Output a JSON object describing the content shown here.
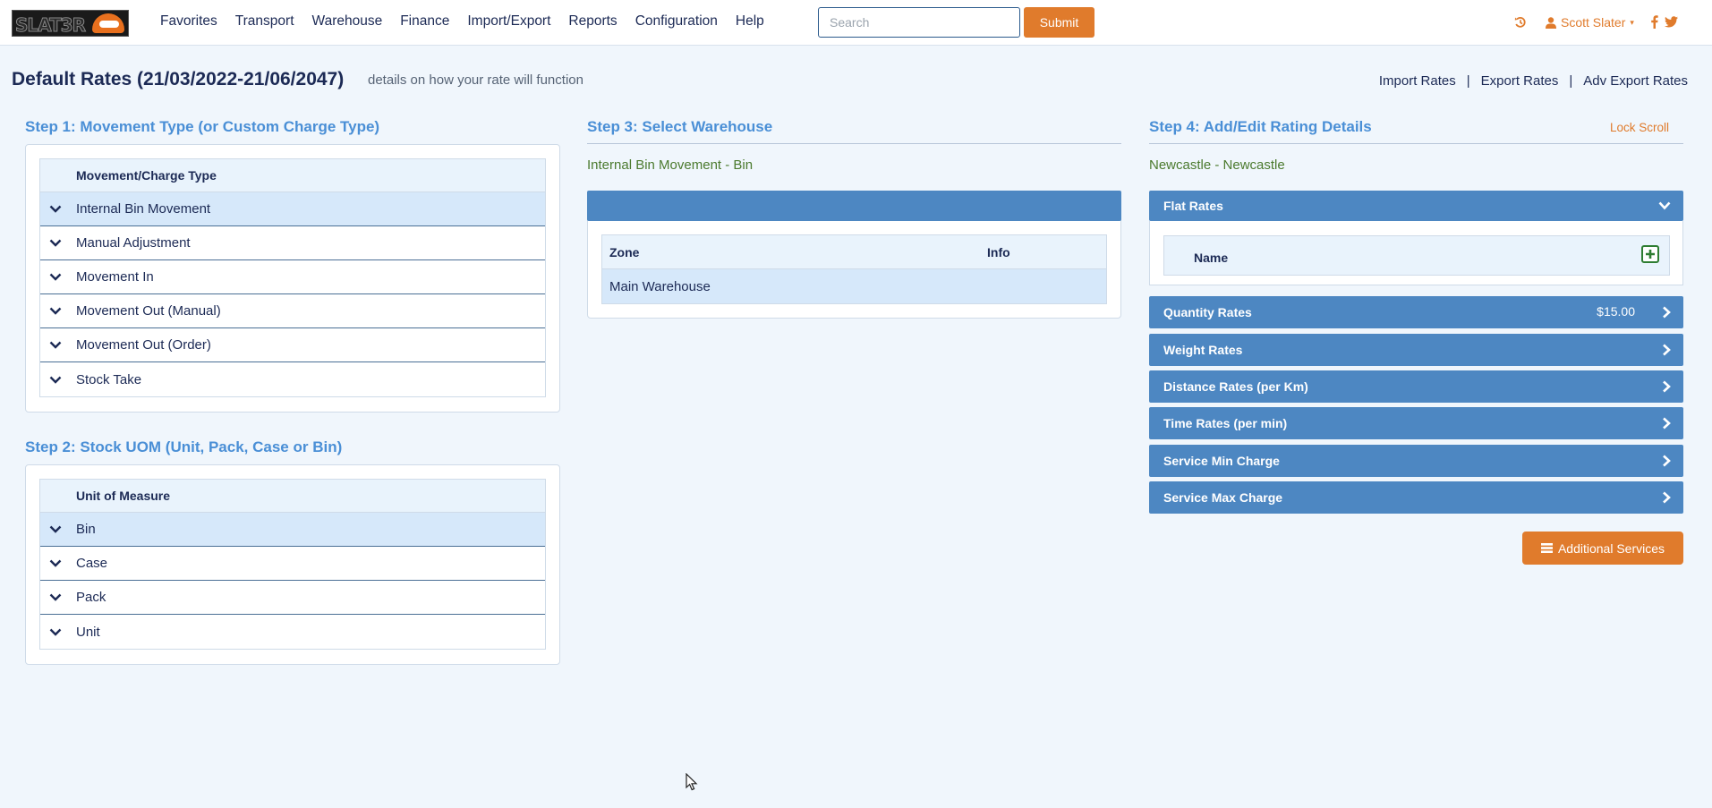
{
  "nav": {
    "logo_text": "SLAT3R",
    "items": [
      "Favorites",
      "Transport",
      "Warehouse",
      "Finance",
      "Import/Export",
      "Reports",
      "Configuration",
      "Help"
    ],
    "search_placeholder": "Search",
    "submit_label": "Submit",
    "user_name": "Scott Slater",
    "icons": [
      "history-icon",
      "user-icon",
      "facebook-icon",
      "twitter-icon"
    ],
    "accent_color": "#e07b2c"
  },
  "header": {
    "title": "Default Rates (21/03/2022-21/06/2047)",
    "subtitle": "details on how your rate will function",
    "links": [
      "Import Rates",
      "Export Rates",
      "Adv Export Rates"
    ]
  },
  "step1": {
    "heading": "Step 1: Movement Type (or Custom Charge Type)",
    "column": "Movement/Charge Type",
    "rows": [
      "Internal Bin Movement",
      "Manual Adjustment",
      "Movement In",
      "Movement Out (Manual)",
      "Movement Out (Order)",
      "Stock Take"
    ],
    "selected": "Internal Bin Movement"
  },
  "step2": {
    "heading": "Step 2: Stock UOM (Unit, Pack, Case or Bin)",
    "column": "Unit of Measure",
    "rows": [
      "Bin",
      "Case",
      "Pack",
      "Unit"
    ],
    "selected": "Bin"
  },
  "step3": {
    "heading": "Step 3: Select Warehouse",
    "subtitle": "Internal Bin Movement - Bin",
    "columns": [
      "Zone",
      "Info"
    ],
    "rows": [
      {
        "zone": "Main Warehouse",
        "info": ""
      }
    ]
  },
  "step4": {
    "heading": "Step 4: Add/Edit Rating Details",
    "lock_scroll": "Lock Scroll",
    "location": "Newcastle - Newcastle",
    "flat_rates": {
      "label": "Flat Rates",
      "column": "Name",
      "expanded": true
    },
    "rates": [
      {
        "label": "Quantity Rates",
        "value": "$15.00"
      },
      {
        "label": "Weight Rates",
        "value": ""
      },
      {
        "label": "Distance Rates (per Km)",
        "value": ""
      },
      {
        "label": "Time Rates (per min)",
        "value": ""
      },
      {
        "label": "Service Min Charge",
        "value": ""
      },
      {
        "label": "Service Max Charge",
        "value": ""
      }
    ],
    "additional_services_label": "Additional Services",
    "bar_color": "#4d87c2"
  }
}
